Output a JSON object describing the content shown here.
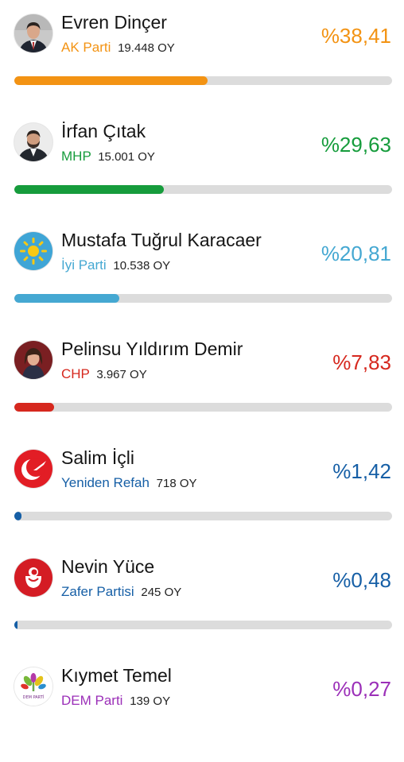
{
  "candidates": [
    {
      "name": "Evren Dinçer",
      "party": "AK Parti",
      "votes": "19.448 OY",
      "percent_label": "%38,41",
      "percent": 38.41,
      "color": "#f39313",
      "avatar": "man-suit-photo"
    },
    {
      "name": "İrfan Çıtak",
      "party": "MHP",
      "votes": "15.001 OY",
      "percent_label": "%29,63",
      "percent": 29.63,
      "color": "#169c3c",
      "avatar": "man-bearded-photo"
    },
    {
      "name": "Mustafa Tuğrul Karacaer",
      "party": "İyi Parti",
      "votes": "10.538 OY",
      "percent_label": "%20,81",
      "percent": 20.81,
      "color": "#45a8d2",
      "avatar": "sun-logo"
    },
    {
      "name": "Pelinsu Yıldırım Demir",
      "party": "CHP",
      "votes": "3.967 OY",
      "percent_label": "%7,83",
      "percent": 7.83,
      "color": "#d6281e",
      "avatar": "woman-photo"
    },
    {
      "name": "Salim İçli",
      "party": "Yeniden Refah",
      "votes": "718 OY",
      "percent_label": "%1,42",
      "percent": 1.42,
      "color": "#165fa6",
      "avatar": "crescent-logo"
    },
    {
      "name": "Nevin Yüce",
      "party": "Zafer Partisi",
      "votes": "245 OY",
      "percent_label": "%0,48",
      "percent": 0.48,
      "color": "#165fa6",
      "avatar": "zafer-logo"
    },
    {
      "name": "Kıymet Temel",
      "party": "DEM Parti",
      "votes": "139 OY",
      "percent_label": "%0,27",
      "percent": 0.27,
      "color": "#9b2fb8",
      "avatar": "dem-logo",
      "logo_text": "DEM PARTİ"
    }
  ]
}
